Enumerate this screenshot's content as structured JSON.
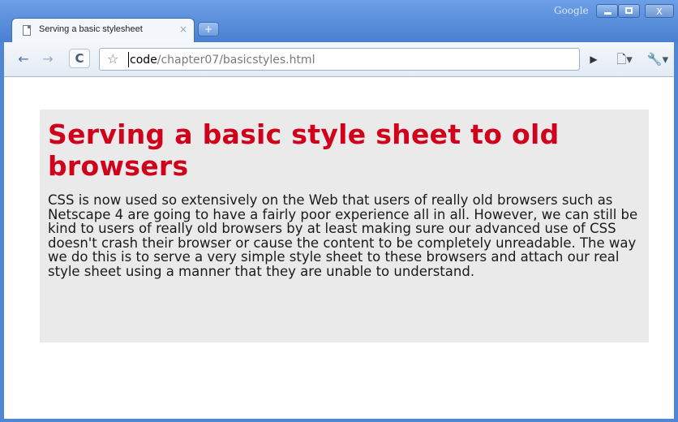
{
  "browser": {
    "brand": "Google",
    "window_controls": {
      "minimize": "–",
      "maximize": "□",
      "close": "X"
    },
    "tab": {
      "title": "Serving a basic stylesheet",
      "close": "×"
    },
    "new_tab": "+",
    "toolbar": {
      "back": "←",
      "forward": "→",
      "reload": "C",
      "star": "☆",
      "go": "▶",
      "page_menu": "🗋▾",
      "tools_menu": "🔧▾"
    },
    "address": {
      "host": "code",
      "path": "/chapter07/basicstyles.html"
    }
  },
  "page": {
    "heading": "Serving a basic style sheet to old browsers",
    "paragraph": "CSS is now used so extensively on the Web that users of really old browsers such as Netscape 4 are going to have a fairly poor experience all in all. However, we can still be kind to users of really old browsers by at least making sure our advanced use of CSS doesn't crash their browser or cause the content to be completely unreadable. The way we do this is to serve a very simple style sheet to these browsers and attach our real style sheet using a manner that they are unable to understand.",
    "colors": {
      "heading": "#d0021b",
      "panel_background": "#eaeaea"
    }
  }
}
